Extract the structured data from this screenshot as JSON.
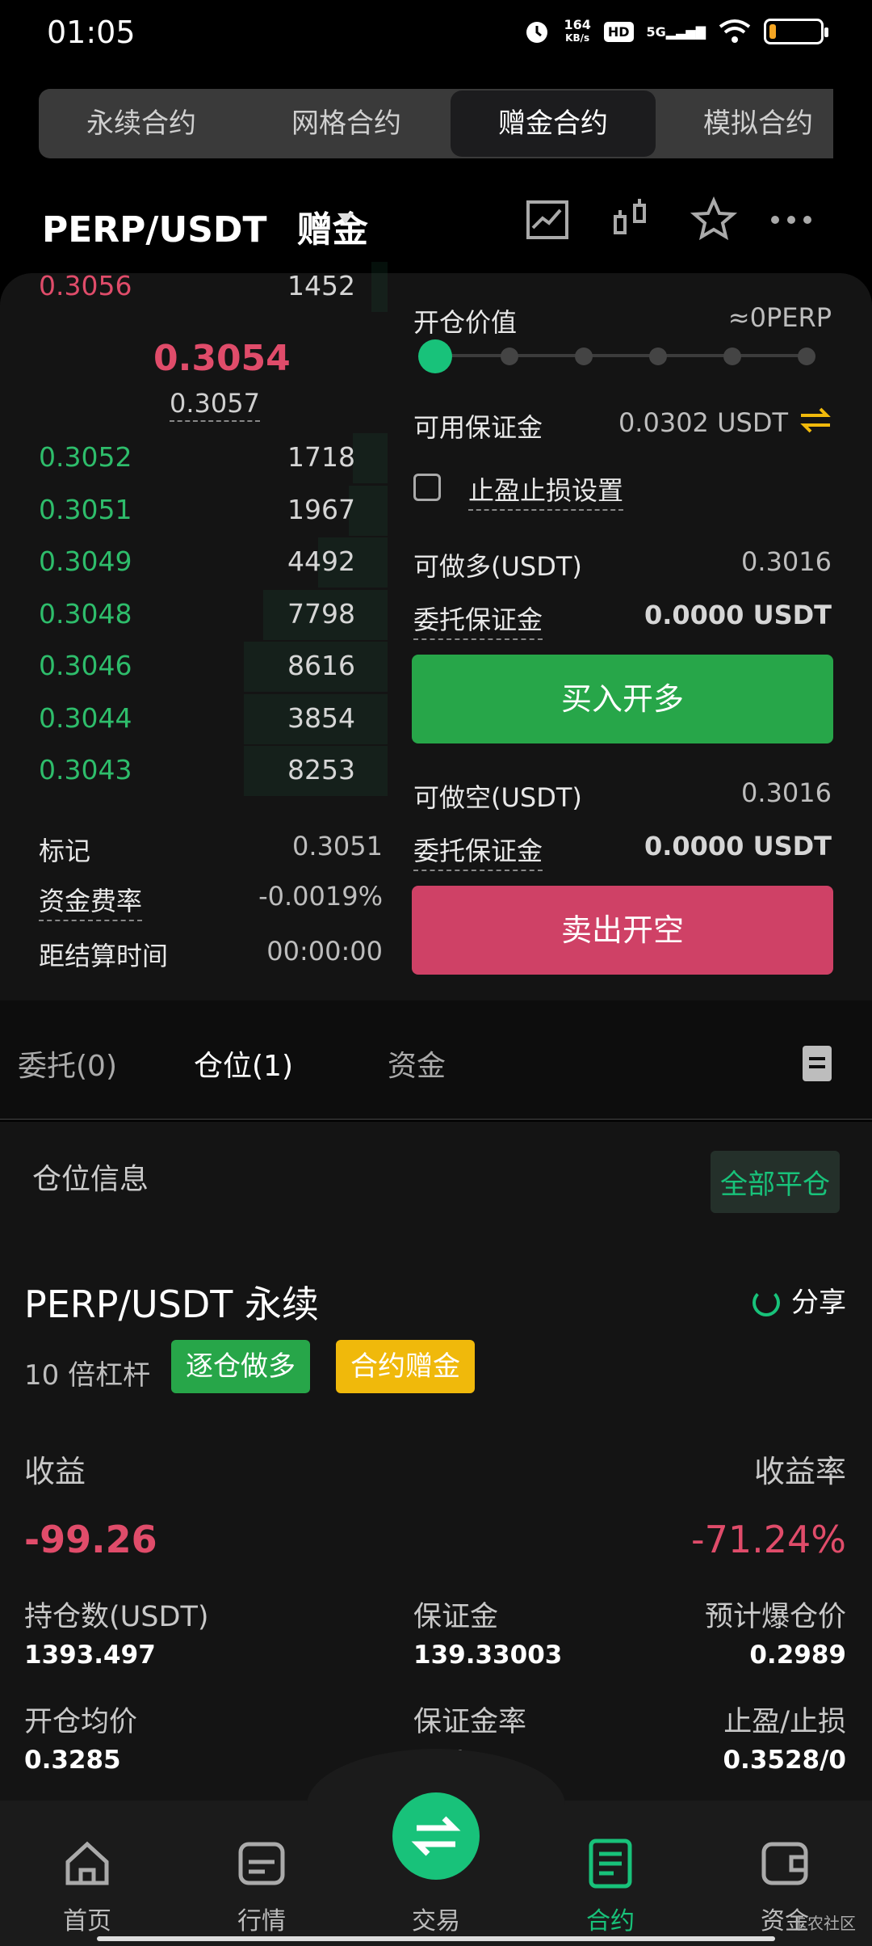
{
  "status": {
    "time": "01:05",
    "net_speed_value": "164",
    "net_speed_unit": "KB/s",
    "hd": "HD",
    "network": "5G"
  },
  "tabs": [
    {
      "label": "永续合约"
    },
    {
      "label": "网格合约"
    },
    {
      "label": "赠金合约"
    },
    {
      "label": "模拟合约"
    }
  ],
  "header": {
    "pair": "PERP/USDT",
    "mode": "赠金"
  },
  "orderbook": {
    "ask": {
      "price": "0.3056",
      "qty": "1452"
    },
    "last_price": "0.3054",
    "mark_price": "0.3057",
    "bids": [
      {
        "price": "0.3052",
        "qty": "1718",
        "depth": 0.09
      },
      {
        "price": "0.3051",
        "qty": "1967",
        "depth": 0.1
      },
      {
        "price": "0.3049",
        "qty": "4492",
        "depth": 0.18
      },
      {
        "price": "0.3048",
        "qty": "7798",
        "depth": 0.32
      },
      {
        "price": "0.3046",
        "qty": "8616",
        "depth": 0.37
      },
      {
        "price": "0.3044",
        "qty": "3854",
        "depth": 0.37
      },
      {
        "price": "0.3043",
        "qty": "8253",
        "depth": 0.37
      }
    ]
  },
  "market_info": {
    "mark_label": "标记",
    "mark_value": "0.3051",
    "funding_label": "资金费率",
    "funding_value": "-0.0019%",
    "settle_label": "距结算时间",
    "settle_value": "00:00:00"
  },
  "order_form": {
    "open_value_label": "开仓价值",
    "open_value": "≈0PERP",
    "slider_level": 0,
    "available_label": "可用保证金",
    "available_value": "0.0302 USDT",
    "tpsl_label": "止盈止损设置",
    "long_label": "可做多(USDT)",
    "long_value": "0.3016",
    "long_margin_label": "委托保证金",
    "long_margin_value": "0.0000 USDT",
    "buy_button": "买入开多",
    "short_label": "可做空(USDT)",
    "short_value": "0.3016",
    "short_margin_label": "委托保证金",
    "short_margin_value": "0.0000 USDT",
    "sell_button": "卖出开空"
  },
  "sub_tabs": [
    {
      "label": "委托(0)"
    },
    {
      "label": "仓位(1)"
    },
    {
      "label": "资金"
    }
  ],
  "position": {
    "title": "仓位信息",
    "close_all": "全部平仓",
    "contract": "PERP/USDT 永续",
    "share": "分享",
    "leverage": "10 倍杠杆",
    "tag_side": "逐仓做多",
    "tag_bonus": "合约赠金",
    "pnl_label": "收益",
    "pnl_value": "-99.26",
    "roe_label": "收益率",
    "roe_value": "-71.24%",
    "size_label": "持仓数(USDT)",
    "size_value": "1393.497",
    "margin_label": "保证金",
    "margin_value": "139.33003",
    "liq_label": "预计爆仓价",
    "liq_value": "0.2989",
    "entry_label": "开仓均价",
    "entry_value": "0.3285",
    "margin_ratio_label": "保证金率",
    "margin_ratio_value": "...%",
    "tpsl_label": "止盈/止损",
    "tpsl_value": "0.3528/0"
  },
  "nav": [
    {
      "label": "首页"
    },
    {
      "label": "行情"
    },
    {
      "label": "交易"
    },
    {
      "label": "合约"
    },
    {
      "label": "资金"
    }
  ],
  "watermark": "卡农社区",
  "colors": {
    "green": "#2ebd6b",
    "red": "#e04c6a",
    "accent": "#18c27a",
    "buy": "#27a649",
    "sell": "#cf4166",
    "bonus": "#f0b90b"
  }
}
